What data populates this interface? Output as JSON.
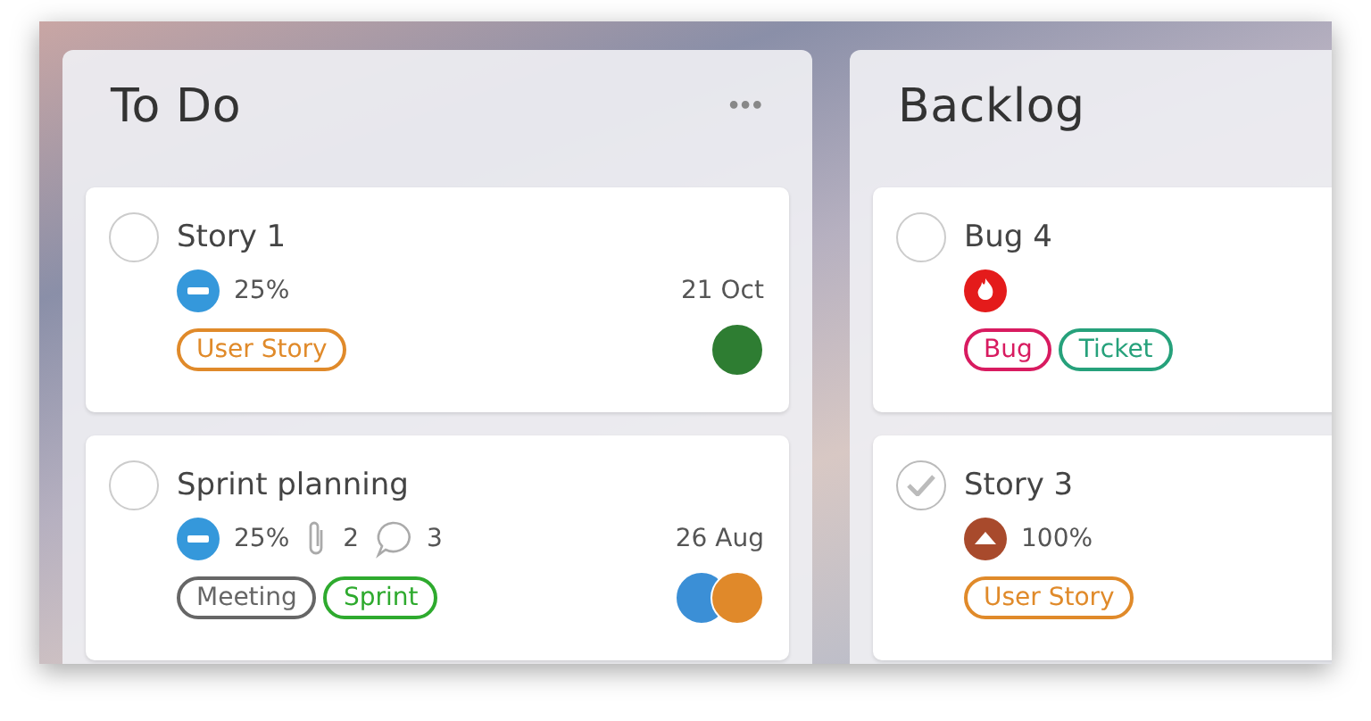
{
  "columns": [
    {
      "title": "To Do",
      "menu": "•••",
      "cards": [
        {
          "title": "Story 1",
          "checked": false,
          "kind": "low",
          "progress": "25%",
          "date": "21 Oct",
          "tags": [
            {
              "label": "User Story",
              "color": "#e08a2a"
            }
          ],
          "avatars": [
            {
              "color": "#2e7d32"
            }
          ]
        },
        {
          "title": "Sprint planning",
          "checked": false,
          "kind": "low",
          "progress": "25%",
          "attachments": "2",
          "comments": "3",
          "date": "26 Aug",
          "tags": [
            {
              "label": "Meeting",
              "color": "#666666"
            },
            {
              "label": "Sprint",
              "color": "#2eaa2e"
            }
          ],
          "avatars": [
            {
              "color": "#3b8fd6"
            },
            {
              "color": "#e0892a"
            }
          ]
        }
      ]
    },
    {
      "title": "Backlog",
      "cards": [
        {
          "title": "Bug 4",
          "checked": false,
          "kind": "critical",
          "tags": [
            {
              "label": "Bug",
              "color": "#d81b60"
            },
            {
              "label": "Ticket",
              "color": "#26a17b"
            }
          ]
        },
        {
          "title": "Story 3",
          "checked": true,
          "kind": "high",
          "progress": "100%",
          "tags": [
            {
              "label": "User Story",
              "color": "#e08a2a"
            }
          ]
        }
      ]
    }
  ]
}
